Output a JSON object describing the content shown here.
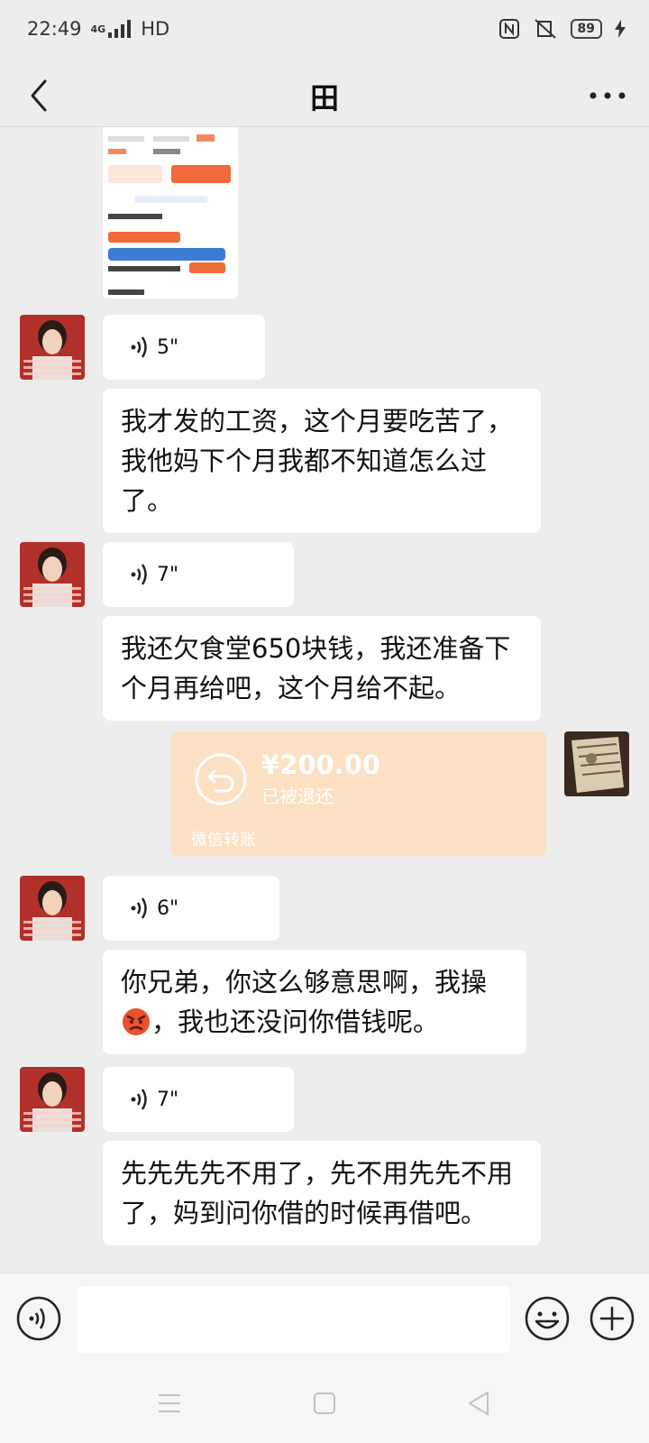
{
  "status_bar": {
    "time": "22:49",
    "network": "4G",
    "hd": "HD",
    "battery": "89"
  },
  "header": {
    "title": "田"
  },
  "messages": {
    "voice1": {
      "duration": "5\""
    },
    "text1": "我才发的工资，这个月要吃苦了，我他妈下个月我都不知道怎么过了。",
    "voice2": {
      "duration": "7\""
    },
    "text2": "我还欠食堂650块钱，我还准备下个月再给吧，这个月给不起。",
    "transfer": {
      "amount": "¥200.00",
      "status": "已被退还",
      "footer": "微信转账"
    },
    "voice3": {
      "duration": "6\""
    },
    "text3a": "你兄弟，你这么够意思啊，我操",
    "text3b": "，我也还没问你借钱呢。",
    "voice4": {
      "duration": "7\""
    },
    "text4": "先先先先不用了，先不用先先不用了，妈到问你借的时候再借吧。"
  },
  "colors": {
    "transfer_bg": "#fce0c3",
    "chat_bg": "#ededed"
  }
}
